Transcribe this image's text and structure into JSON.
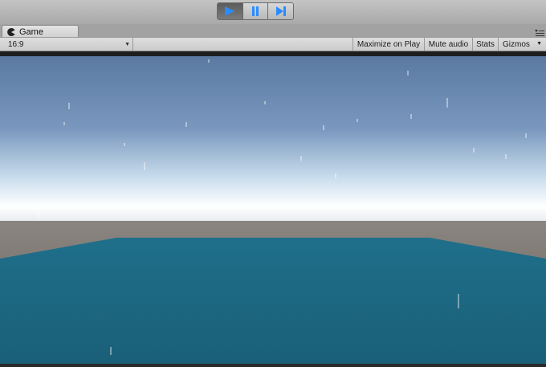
{
  "window": {
    "tab_title": "Game"
  },
  "playback": {
    "play_icon": "play-icon",
    "pause_icon": "pause-icon",
    "step_icon": "step-icon",
    "playing": true
  },
  "game_toolbar": {
    "aspect_value": "16:9",
    "maximize_label": "Maximize on Play",
    "mute_label": "Mute audio",
    "stats_label": "Stats",
    "gizmos_label": "Gizmos"
  },
  "colors": {
    "play_accent": "#2a8cff",
    "sky_top": "#5a7aa2",
    "horizon_glow": "#ffffff",
    "ground_brown": "#6e6660",
    "water_teal": "#1e6f8a"
  }
}
